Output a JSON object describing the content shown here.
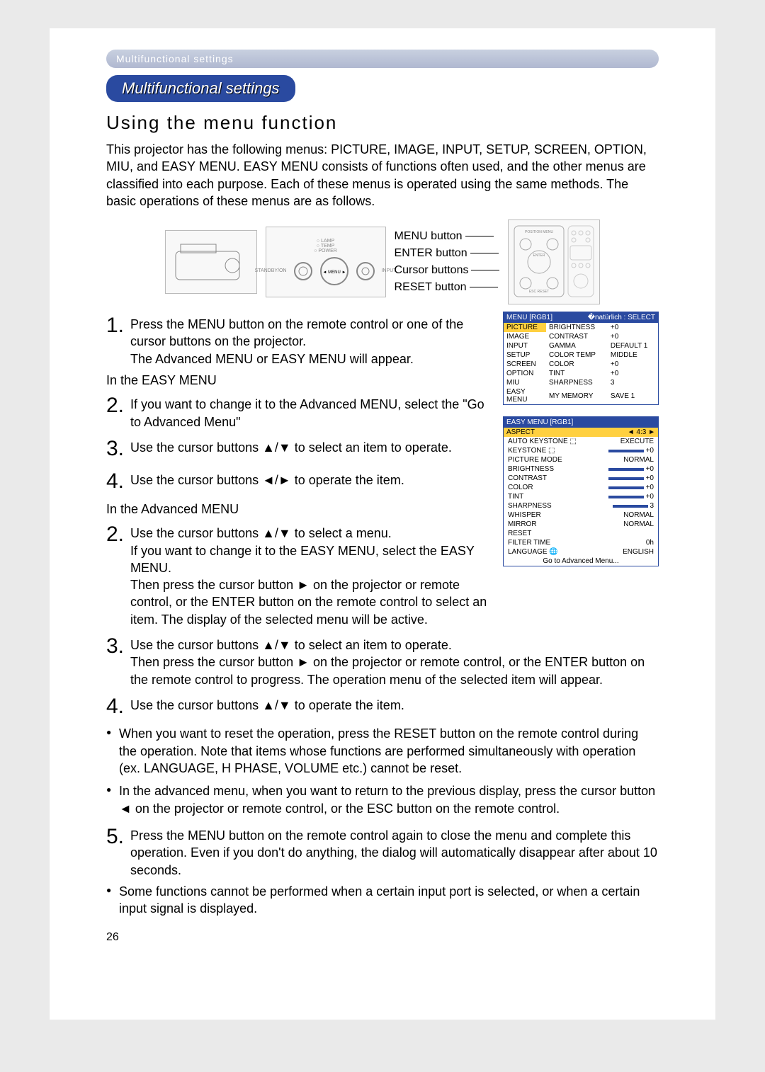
{
  "crumb": "Multifunctional settings",
  "pill": "Multifunctional settings",
  "heading": "Using the menu function",
  "intro": "This projector has the following menus: PICTURE, IMAGE, INPUT, SETUP, SCREEN, OPTION, MIU, and EASY MENU. EASY MENU consists of functions often used, and the other menus are classified into each purpose. Each of these menus is operated using the same methods. The basic operations of these menus are as follows.",
  "btn_labels": {
    "menu": "MENU button",
    "enter": "ENTER button",
    "cursor": "Cursor buttons",
    "reset": "RESET button"
  },
  "panel": {
    "lamp": "LAMP",
    "temp": "TEMP",
    "power": "POWER",
    "standby": "STANDBY/ON",
    "input": "INPUT",
    "menu": "MENU"
  },
  "step1": "Press the MENU button on the remote control or one of the cursor buttons on the projector.\nThe Advanced MENU or EASY MENU will appear.",
  "easy_head": "In the EASY MENU",
  "easy2": "If you want to change it to the Advanced MENU, select the \"Go to Advanced Menu\"",
  "easy3": "Use the cursor buttons ▲/▼ to select an item to operate.",
  "easy4": "Use the cursor buttons ◄/► to operate the item.",
  "adv_head": "In the Advanced MENU",
  "adv2": "Use the cursor buttons ▲/▼ to select a menu.\nIf you want to change it to the EASY MENU, select the EASY MENU.\nThen press the cursor button ► on the projector or remote control, or the ENTER button on the remote control to select an item. The display of the selected menu will be active.",
  "adv3": "Use the cursor buttons ▲/▼ to select an item to operate.\nThen press the cursor button ► on the projector or remote control, or the ENTER button on the remote control to progress. The operation menu of the selected item will appear.",
  "adv4": "Use the cursor buttons ▲/▼ to operate the item.",
  "bul1": "When you want to reset the operation, press the RESET button on the remote control during the operation. Note that items whose functions are performed simultaneously with operation (ex. LANGUAGE, H PHASE, VOLUME etc.) cannot be reset.",
  "bul2": "In the advanced menu, when you want to return to the previous display, press the cursor button ◄ on the projector or remote control, or the ESC button on the remote control.",
  "step5": "Press the MENU button on the remote control again to close the menu and complete this operation. Even if you don't do anything, the dialog will automatically disappear after about 10 seconds.",
  "bul3": "Some functions cannot be performed when a certain input port is selected, or when a certain input signal is displayed.",
  "page_num": "26",
  "osd1": {
    "title_left": "MENU [RGB1]",
    "title_right": "SELECT",
    "rows": [
      [
        "PICTURE",
        "BRIGHTNESS",
        "+0"
      ],
      [
        "IMAGE",
        "CONTRAST",
        "+0"
      ],
      [
        "INPUT",
        "GAMMA",
        "DEFAULT 1"
      ],
      [
        "SETUP",
        "COLOR TEMP",
        "MIDDLE"
      ],
      [
        "SCREEN",
        "COLOR",
        "+0"
      ],
      [
        "OPTION",
        "TINT",
        "+0"
      ],
      [
        "MIU",
        "SHARPNESS",
        "3"
      ],
      [
        "EASY MENU",
        "MY MEMORY",
        "SAVE 1"
      ]
    ]
  },
  "osd2": {
    "title": "EASY MENU [RGB1]",
    "aspect_label": "ASPECT",
    "aspect_val": "4:3",
    "rows": [
      [
        "AUTO KEYSTONE ⬚",
        "EXECUTE"
      ],
      [
        "KEYSTONE ⬚",
        "+0"
      ],
      [
        "PICTURE MODE",
        "NORMAL"
      ],
      [
        "BRIGHTNESS",
        "+0"
      ],
      [
        "CONTRAST",
        "+0"
      ],
      [
        "COLOR",
        "+0"
      ],
      [
        "TINT",
        "+0"
      ],
      [
        "SHARPNESS",
        "3"
      ],
      [
        "WHISPER",
        "NORMAL"
      ],
      [
        "MIRROR",
        "NORMAL"
      ],
      [
        "RESET",
        ""
      ],
      [
        "FILTER TIME",
        "0h"
      ],
      [
        "LANGUAGE  🌐",
        "ENGLISH"
      ]
    ],
    "footer": "Go to Advanced Menu..."
  }
}
